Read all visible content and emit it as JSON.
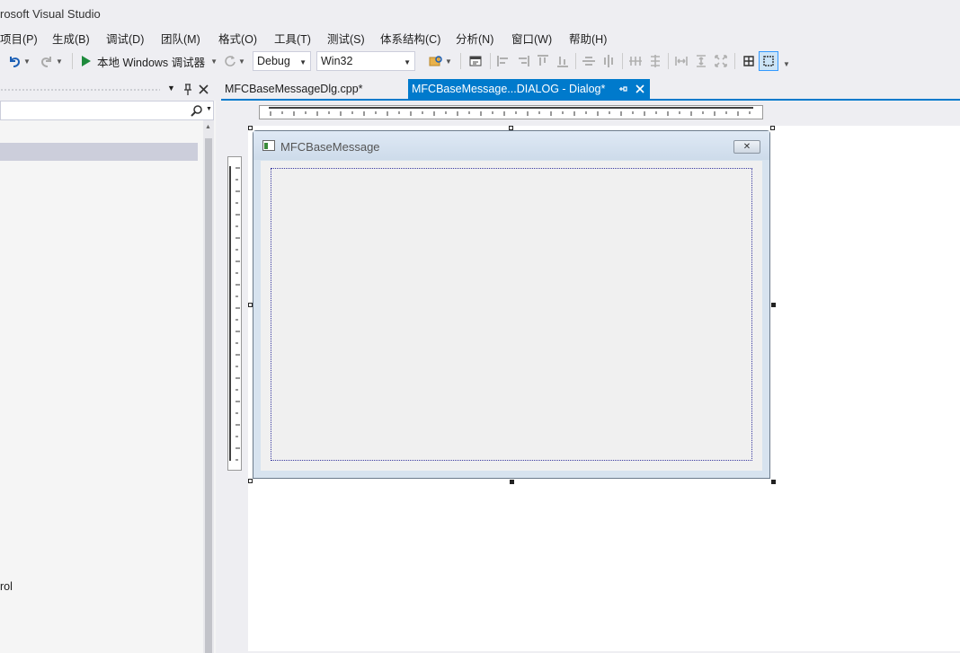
{
  "window": {
    "title": "rosoft Visual Studio"
  },
  "menu": [
    {
      "label": "项目(P)"
    },
    {
      "label": "生成(B)"
    },
    {
      "label": "调试(D)"
    },
    {
      "label": "团队(M)"
    },
    {
      "label": "格式(O)"
    },
    {
      "label": "工具(T)"
    },
    {
      "label": "测试(S)"
    },
    {
      "label": "体系结构(C)"
    },
    {
      "label": "分析(N)"
    },
    {
      "label": "窗口(W)"
    },
    {
      "label": "帮助(H)"
    }
  ],
  "toolbar": {
    "run_label": "本地 Windows 调试器",
    "config_value": "Debug",
    "platform_value": "Win32"
  },
  "left_panel": {
    "visible_text": "rol"
  },
  "tabs": [
    {
      "label": "MFCBaseMessageDlg.cpp*",
      "active": false
    },
    {
      "label": "MFCBaseMessage...DIALOG - Dialog*",
      "active": true
    }
  ],
  "dialog": {
    "title": "MFCBaseMessage",
    "close_glyph": "✕"
  },
  "colors": {
    "accent": "#007acc",
    "run_green": "#1e8a3c"
  }
}
